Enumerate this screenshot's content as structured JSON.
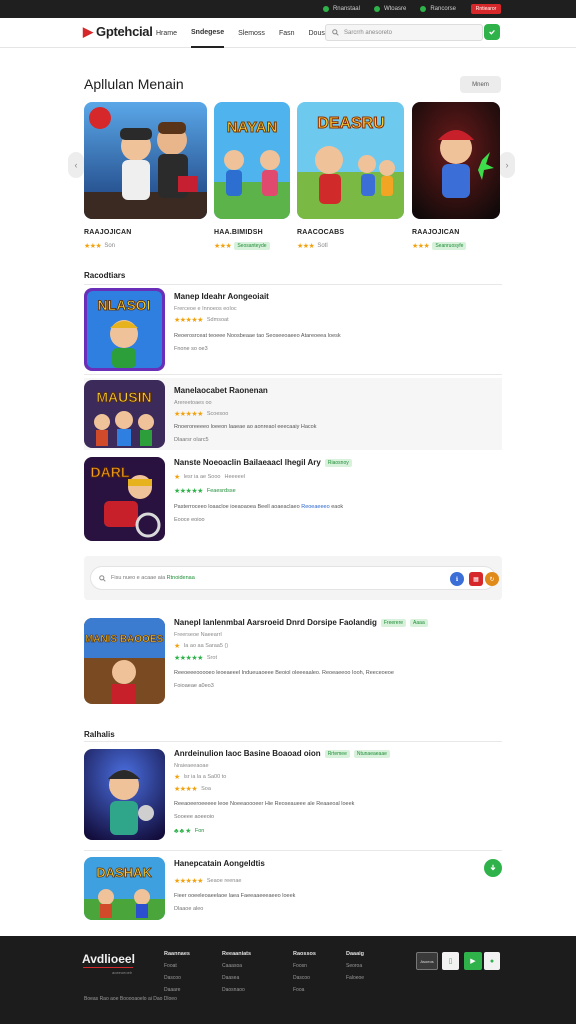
{
  "topbar": {
    "links": [
      "Rnanstaal",
      "Wtoasre",
      "Rancorse"
    ],
    "button": "Rntiearor"
  },
  "header": {
    "logo": "Gptehcial",
    "nav": [
      "Hrame",
      "Sndegese",
      "Slemoss",
      "Fasn",
      "Dous"
    ],
    "search_placeholder": "Sarcrrh anesoreto"
  },
  "featured": {
    "title": "Apllulan Menain",
    "more_button": "Mnem",
    "cards": [
      {
        "name": "RAAJOJICAN",
        "rating_text": "Son",
        "art_text": "",
        "badge": ""
      },
      {
        "name": "HAA.BIMIDSH",
        "rating_text": "",
        "art_text": "NAYAN",
        "badge": "Seosanteyde"
      },
      {
        "name": "RAACOCABS",
        "rating_text": "Sotl",
        "art_text": "DEASRU",
        "badge": ""
      },
      {
        "name": "RAAJOJICAN",
        "rating_text": "",
        "art_text": "",
        "badge": "Seanruosyfe"
      }
    ]
  },
  "section1": {
    "title": "Racodtiars",
    "rows": [
      {
        "title": "Manep Ideahr Aongeoiait",
        "tag": "",
        "line1": "Frerceoe e Innoeos eoIoc",
        "stars_text": "Sdmsoat",
        "desc": "Reoerosrceat teoeee Noosbeaae tao Seoseeoaeeo Atareoeea loesk",
        "meta": "Fnone so oe3",
        "art_text": "NLASOI"
      },
      {
        "title": "Manelaocabet Raonenan",
        "tag": "",
        "line1": "Arereetoaes oo",
        "stars_text": "Scoesoo",
        "desc": "Rnoeroreeeeo loeeon laaeae ao aonreaol eeecaaiy Hacok",
        "meta": "Dlaarsr oIarc5",
        "art_text": "MAUSIN"
      },
      {
        "title": "Nanste Noeoaclin Bailaeaacl lhegil Ary",
        "tag": "Riaosnoy",
        "line1": "Heeeeel",
        "line1b": "lesr ia ae Sooo",
        "stars_text": "Feaesrdsse",
        "desc": "Pasterroceeo loaacloe ioeaoaoea Beell aoaeaclaeo",
        "desc_link": "Reoeaeeeo",
        "desc_end": "eaok",
        "meta": "Eooce eoioo",
        "art_text": "DARL"
      }
    ]
  },
  "ad_panel": {
    "text_plain": "Fisu nueo e acaae aia",
    "text_green": "Rtnoidenaa"
  },
  "section_mid": {
    "row": {
      "title": "Nanepl Ianlenmbal Aarsroeid Dnrd Dorsipe Faolandig",
      "tags": [
        "Freerere",
        "Aaaa"
      ],
      "line1": "Freerseoe Naeearrl",
      "line2": "Ia ao aa Saraa5 ()",
      "stars_text": "Srot",
      "desc": "Reeoeeeooooeo leoeaeeel Indueuaoeee Beoiol oleeeaaleo. Reoeaeeoo Iooh, Reeceoeoe",
      "meta": "Foioaeae a0eo3",
      "art_text": "MANIS BAOOES"
    }
  },
  "section2": {
    "title": "Ralhalis",
    "rows": [
      {
        "title": "Anrdeinulion Iaoc Basine Boaoad oion",
        "tags": [
          "Rrtemee",
          "Ntunaeaeaae"
        ],
        "line1": "Nraieaeeaoae",
        "line2": "lsr ia la a Sa00 to",
        "stars_text": "Soa",
        "desc": "Reeaoeeroeeeee leoe Noeeaoooeer Hie Reoseaueee ale Reaaeoal loeek",
        "meta": "Sooeee aoeeoio",
        "action": "Fon",
        "art_text": ""
      },
      {
        "title": "Hanepcatain Aongeldtis",
        "tags": [],
        "line1": "",
        "stars_text": "Seaoe reenae",
        "desc": "Fieer ooeeleoaeelaoe laea Faeeaaeeeaeeo loeek",
        "meta": "Dlaaoe aleo",
        "art_text": "DASHAK"
      }
    ]
  },
  "footer": {
    "logo": "Avdlioeel",
    "tagline": "aoeeoeoelr",
    "columns": [
      {
        "heading": "Raannaes",
        "items": [
          "Fooat",
          "Dascoo",
          "Daaare"
        ]
      },
      {
        "heading": "Reeaaniats",
        "items": [
          "Caaasoa",
          "Daasea",
          "Daosnaoo"
        ]
      },
      {
        "heading": "Raossos",
        "items": [
          "Foosn",
          "Dascoo",
          "Fooa"
        ]
      },
      {
        "heading": "Daaaig",
        "items": [
          "Seoroa",
          "Faloeoe"
        ]
      }
    ],
    "copyright": "Boeas Rao aoe Booooaoelo ai Dao Dloeo",
    "badge_text": "Asoeos"
  },
  "colors": {
    "accent_green": "#2fb24a",
    "accent_red": "#d6272a",
    "star": "#f3a20f",
    "footer_bg": "#1c1c1c"
  },
  "icons": [
    "search-icon",
    "chevron-left-icon",
    "chevron-right-icon",
    "download-icon",
    "star-icon"
  ]
}
